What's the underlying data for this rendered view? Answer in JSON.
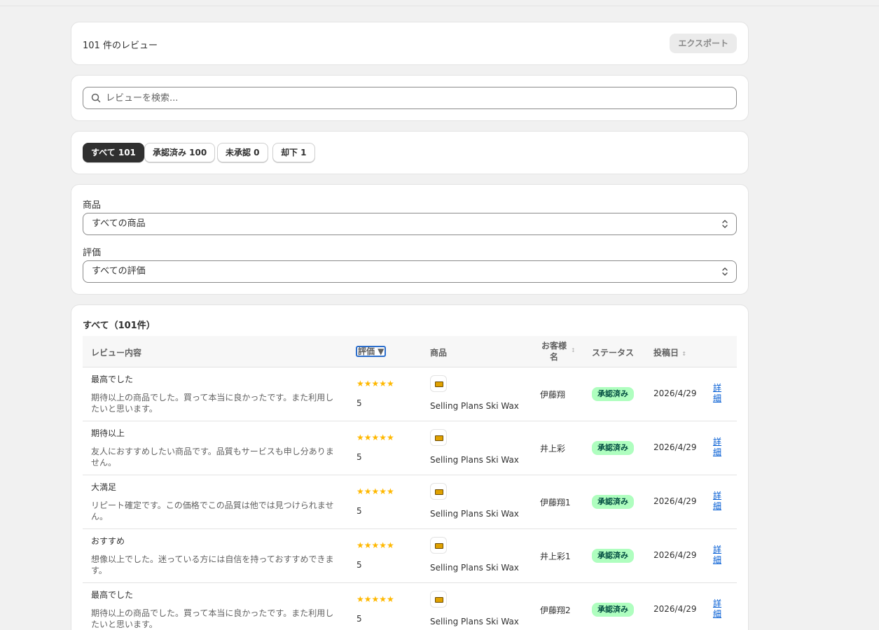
{
  "header": {
    "review_count": "101 件のレビュー",
    "export_label": "エクスポート"
  },
  "search": {
    "placeholder": "レビューを検索...",
    "value": ""
  },
  "tabs": [
    {
      "label": "すべて 101",
      "active": true
    },
    {
      "label": "承認済み 100",
      "active": false
    },
    {
      "label": "未承認 0",
      "active": false
    },
    {
      "label": "却下 1",
      "active": false
    }
  ],
  "filters": {
    "product": {
      "label": "商品",
      "value": "すべての商品"
    },
    "rating": {
      "label": "評価",
      "value": "すべての評価"
    }
  },
  "table": {
    "title": "すべて（101件）",
    "columns": {
      "content": "レビュー内容",
      "rating": "評価 ▼",
      "product": "商品",
      "customer": "お客様名",
      "status": "ステータス",
      "date": "投稿日"
    },
    "rows": [
      {
        "title": "最高でした",
        "body": "期待以上の商品でした。買って本当に良かったです。また利用したいと思います。",
        "stars": "★★★★★",
        "rating": "5",
        "product": "Selling Plans Ski Wax",
        "customer": "伊藤翔",
        "status": "承認済み",
        "date": "2026/4/29",
        "detail": "詳細"
      },
      {
        "title": "期待以上",
        "body": "友人におすすめしたい商品です。品質もサービスも申し分ありません。",
        "stars": "★★★★★",
        "rating": "5",
        "product": "Selling Plans Ski Wax",
        "customer": "井上彩",
        "status": "承認済み",
        "date": "2026/4/29",
        "detail": "詳細"
      },
      {
        "title": "大満足",
        "body": "リピート確定です。この価格でこの品質は他では見つけられません。",
        "stars": "★★★★★",
        "rating": "5",
        "product": "Selling Plans Ski Wax",
        "customer": "伊藤翔1",
        "status": "承認済み",
        "date": "2026/4/29",
        "detail": "詳細"
      },
      {
        "title": "おすすめ",
        "body": "想像以上でした。迷っている方には自信を持っておすすめできます。",
        "stars": "★★★★★",
        "rating": "5",
        "product": "Selling Plans Ski Wax",
        "customer": "井上彩1",
        "status": "承認済み",
        "date": "2026/4/29",
        "detail": "詳細"
      },
      {
        "title": "最高でした",
        "body": "期待以上の商品でした。買って本当に良かったです。また利用したいと思います。",
        "stars": "★★★★★",
        "rating": "5",
        "product": "Selling Plans Ski Wax",
        "customer": "伊藤翔2",
        "status": "承認済み",
        "date": "2026/4/29",
        "detail": "詳細"
      }
    ]
  },
  "colors": {
    "accent_dark": "#303030",
    "badge_bg": "#affebf",
    "badge_text": "#014b40",
    "star": "#ffb800",
    "link": "#005bd3"
  },
  "icons": {
    "search": "search-icon",
    "select": "chevron-up-down-icon",
    "thumb": "product-thumbnail"
  }
}
